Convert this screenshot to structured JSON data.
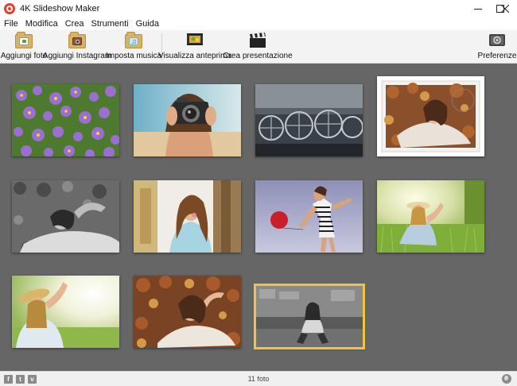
{
  "window": {
    "title": "4K Slideshow Maker",
    "controls": [
      "minimize-icon",
      "maximize-icon",
      "close-icon"
    ]
  },
  "menu": {
    "items": [
      "File",
      "Modifica",
      "Crea",
      "Strumenti",
      "Guida"
    ]
  },
  "toolbar": {
    "add_photo": "Aggiungi foto",
    "add_instagram": "Aggiungi Instagram",
    "set_music": "Imposta musica",
    "preview": "Visualizza anteprima",
    "create": "Crea presentazione",
    "preferences": "Preferenze"
  },
  "photos": [
    {
      "id": 1,
      "subject": "purple-flowers"
    },
    {
      "id": 2,
      "subject": "woman-with-camera"
    },
    {
      "id": 3,
      "subject": "industrial-machine"
    },
    {
      "id": 4,
      "subject": "stamp-frame-woman-leaves"
    },
    {
      "id": 5,
      "subject": "woman-lying-grayscale"
    },
    {
      "id": 6,
      "subject": "woman-blowing-bubble"
    },
    {
      "id": 7,
      "subject": "woman-red-balloon"
    },
    {
      "id": 8,
      "subject": "woman-sitting-grass"
    },
    {
      "id": 9,
      "subject": "woman-straw-hat"
    },
    {
      "id": 10,
      "subject": "woman-lying-autumn-leaves"
    },
    {
      "id": 11,
      "subject": "woman-sitting-bw",
      "selected": true
    }
  ],
  "status": {
    "photo_count": "11 foto",
    "social_icons": [
      "facebook-icon",
      "twitter-icon",
      "vimeo-icon"
    ]
  },
  "colors": {
    "workspace": "#666666",
    "selection": "#f0c347",
    "toolbar": "#f3f3f3",
    "app_accent": "#e2402b"
  }
}
